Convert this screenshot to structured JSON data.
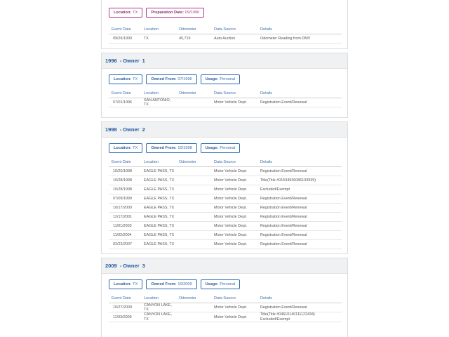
{
  "cards": [
    {
      "badges": [
        {
          "label": "Location:",
          "value": "TX",
          "style": "purple"
        },
        {
          "label": "Preparation Date:",
          "value": "09/1990",
          "style": "purple"
        }
      ],
      "columns": [
        "Event Date",
        "Location",
        "Odometer",
        "Data Source",
        "Details"
      ],
      "rows": [
        [
          "09/26/1990",
          "TX",
          "45,719",
          "Auto Auction",
          "Odometer Reading from DMV"
        ]
      ]
    },
    {
      "header": {
        "year": "1996",
        "owner_word": "- Owner",
        "owner_num": "1"
      },
      "badges": [
        {
          "label": "Location:",
          "value": "TX",
          "style": "blue"
        },
        {
          "label": "Owned From:",
          "value": "07/1996",
          "style": "blue"
        },
        {
          "label": "Usage:",
          "value": "Personal",
          "style": "blue"
        }
      ],
      "columns": [
        "Event Date",
        "Location",
        "Odometer",
        "Data Source",
        "Details"
      ],
      "rows": [
        [
          "07/01/1996",
          "SAN ANTONIO,\nTX",
          "",
          "Motor Vehicle Dept.",
          "Registration Event/Renewal"
        ]
      ]
    },
    {
      "header": {
        "year": "1998",
        "owner_word": "- Owner",
        "owner_num": "2"
      },
      "badges": [
        {
          "label": "Location:",
          "value": "TX",
          "style": "blue"
        },
        {
          "label": "Owned From:",
          "value": "10/1998",
          "style": "blue"
        },
        {
          "label": "Usage:",
          "value": "Personal",
          "style": "blue"
        }
      ],
      "columns": [
        "Event Date",
        "Location",
        "Odometer",
        "Data Source",
        "Details"
      ],
      "rows": [
        [
          "10/20/1998",
          "EAGLE PASS, TX",
          "",
          "Motor Vehicle Dept.",
          "Registration Event/Renewal"
        ],
        [
          "10/28/1998",
          "EAGLE PASS, TX",
          "",
          "Motor Vehicle Dept.",
          "Title(Title #01534936086133939)"
        ],
        [
          "10/28/1998",
          "EAGLE PASS, TX",
          "",
          "Motor Vehicle Dept.",
          "Excluded/Exempt"
        ],
        [
          "07/09/1999",
          "EAGLE PASS, TX",
          "",
          "Motor Vehicle Dept.",
          "Registration Event/Renewal"
        ],
        [
          "10/17/2000",
          "EAGLE PASS, TX",
          "",
          "Motor Vehicle Dept.",
          "Registration Event/Renewal"
        ],
        [
          "12/17/2001",
          "EAGLE PASS, TX",
          "",
          "Motor Vehicle Dept.",
          "Registration Event/Renewal"
        ],
        [
          "11/01/2003",
          "EAGLE PASS, TX",
          "",
          "Motor Vehicle Dept.",
          "Registration Event/Renewal"
        ],
        [
          "11/02/2004",
          "EAGLE PASS, TX",
          "",
          "Motor Vehicle Dept.",
          "Registration Event/Renewal"
        ],
        [
          "02/22/2007",
          "EAGLE PASS, TX",
          "",
          "Motor Vehicle Dept.",
          "Registration Event/Renewal"
        ]
      ]
    },
    {
      "header": {
        "year": "2009",
        "owner_word": "- Owner",
        "owner_num": "3"
      },
      "badges": [
        {
          "label": "Location:",
          "value": "TX",
          "style": "blue"
        },
        {
          "label": "Owned From:",
          "value": "10/2009",
          "style": "blue"
        },
        {
          "label": "Usage:",
          "value": "Personal",
          "style": "blue"
        }
      ],
      "columns": [
        "Event Date",
        "Location",
        "Odometer",
        "Data Source",
        "Details"
      ],
      "rows": [
        [
          "10/27/2009",
          "CANYON LAKE,\nTX",
          "",
          "Motor Vehicle Dept.",
          "Registration Event/Renewal"
        ],
        [
          "11/03/2009",
          "CANYON LAKE,\nTX",
          "",
          "Motor Vehicle Dept.",
          "Title(Title #04610140111122434)\nExcluded/Exempt"
        ]
      ]
    }
  ]
}
